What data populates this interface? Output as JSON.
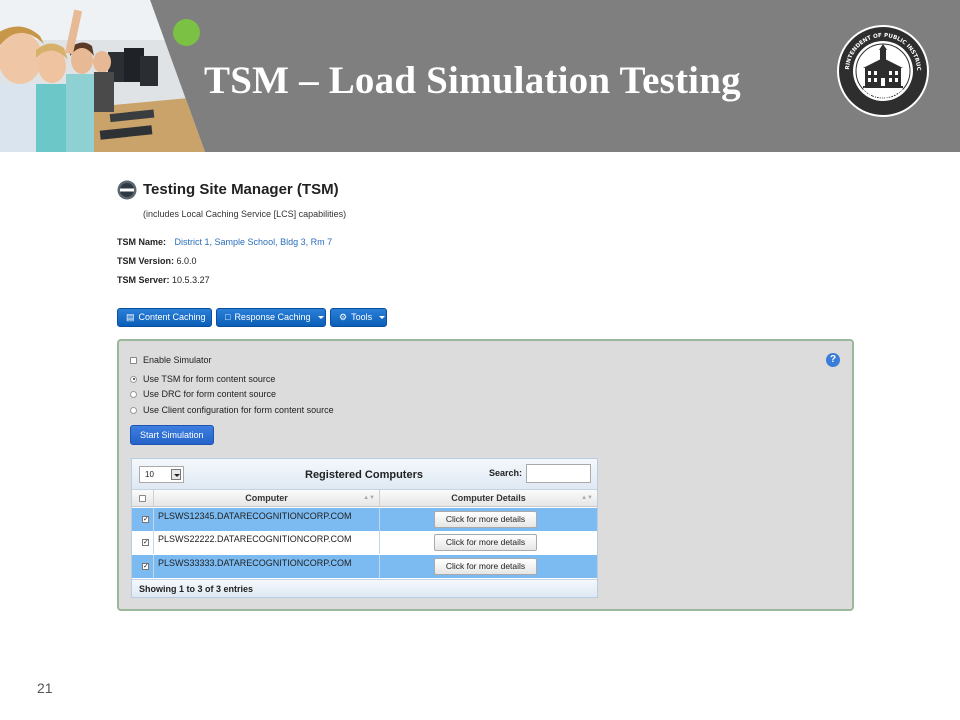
{
  "slide": {
    "title": "TSM – Load Simulation Testing",
    "number": "21",
    "seal_text": [
      "SUPERINTENDENT OF PUBLIC INSTRUCTION",
      "WASHINGTON"
    ]
  },
  "tsm": {
    "title": "Testing Site Manager (TSM)",
    "subtitle": "(includes Local Caching Service [LCS] capabilities)",
    "name_label": "TSM Name:",
    "name_value": "District 1, Sample School, Bldg 3, Rm 7",
    "version_label": "TSM Version:",
    "version_value": "6.0.0",
    "server_label": "TSM Server:",
    "server_value": "10.5.3.27"
  },
  "toolbar": {
    "content_caching": "Content Caching",
    "response_caching": "Response Caching",
    "tools": "Tools"
  },
  "simulator": {
    "enable_label": "Enable Simulator",
    "enabled": false,
    "options": [
      {
        "label": "Use TSM for form content source",
        "selected": true
      },
      {
        "label": "Use DRC for form content source",
        "selected": false
      },
      {
        "label": "Use Client configuration for form content source",
        "selected": false
      }
    ],
    "start_label": "Start Simulation",
    "help": "?"
  },
  "grid": {
    "page_length": "10",
    "title": "Registered Computers",
    "search_label": "Search:",
    "search_value": "",
    "columns": [
      "Computer",
      "Computer Details"
    ],
    "rows": [
      {
        "computer": "PLSWS12345.DATARECOGNITIONCORP.COM",
        "details": "Click for more details",
        "checked": true
      },
      {
        "computer": "PLSWS22222.DATARECOGNITIONCORP.COM",
        "details": "Click for more details",
        "checked": true
      },
      {
        "computer": "PLSWS33333.DATARECOGNITIONCORP.COM",
        "details": "Click for more details",
        "checked": true
      }
    ],
    "footer": "Showing 1 to 3 of 3 entries"
  },
  "colors": {
    "banner": "#7f7f7f",
    "accent_green": "#7bc143",
    "button_blue": "#0c5fb8",
    "row_highlight": "#7bbbf2"
  }
}
